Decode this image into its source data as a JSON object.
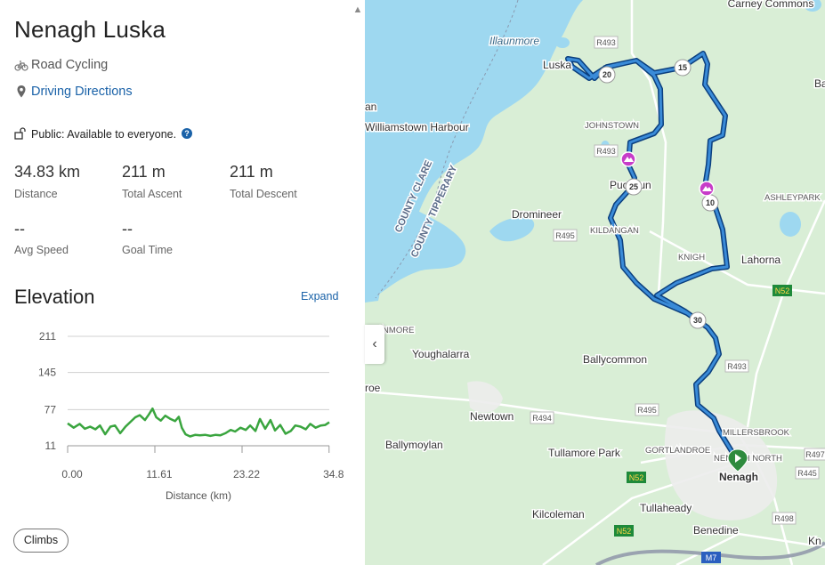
{
  "route": {
    "title": "Nenagh Luska",
    "activity_type": "Road Cycling",
    "directions_link": "Driving Directions",
    "privacy": "Public: Available to everyone.",
    "help_glyph": "?"
  },
  "stats": [
    {
      "value": "34.83 km",
      "label": "Distance"
    },
    {
      "value": "211 m",
      "label": "Total Ascent"
    },
    {
      "value": "211 m",
      "label": "Total Descent"
    },
    {
      "value": "--",
      "label": "Avg Speed"
    },
    {
      "value": "--",
      "label": "Goal Time"
    }
  ],
  "elevation": {
    "title": "Elevation",
    "expand_label": "Expand",
    "climbs_button": "Climbs"
  },
  "chart_data": {
    "type": "line",
    "xlabel": "Distance (km)",
    "ylabel": "",
    "x_ticks": [
      "0.00",
      "11.61",
      "23.22",
      "34.8"
    ],
    "y_ticks": [
      "211",
      "145",
      "77",
      "11"
    ],
    "xlim": [
      0,
      34.83
    ],
    "ylim": [
      11,
      211
    ],
    "grid": true,
    "line_color": "#3aa53f",
    "series": [
      {
        "x": [
          0,
          0.8,
          1.6,
          2.3,
          3.0,
          3.7,
          4.3,
          5.0,
          5.7,
          6.3,
          7.0,
          7.7,
          8.3,
          9.0,
          9.6,
          10.3,
          10.8,
          11.3,
          11.8,
          12.4,
          13.0,
          13.7,
          14.3,
          14.8,
          15.2,
          15.7,
          16.3,
          17.0,
          17.6,
          18.3,
          19.0,
          19.7,
          20.3,
          21.0,
          21.7,
          22.3,
          23.0,
          23.7,
          24.3,
          25.0,
          25.6,
          26.3,
          27.0,
          27.6,
          28.3,
          29.0,
          29.7,
          30.3,
          31.0,
          31.7,
          32.3,
          33.0,
          33.7,
          34.3,
          34.83
        ],
        "y": [
          52,
          44,
          51,
          42,
          46,
          41,
          48,
          32,
          46,
          48,
          34,
          46,
          54,
          63,
          67,
          58,
          68,
          79,
          63,
          57,
          66,
          60,
          56,
          64,
          44,
          32,
          28,
          31,
          30,
          31,
          29,
          31,
          30,
          34,
          40,
          37,
          44,
          40,
          48,
          38,
          60,
          42,
          58,
          39,
          49,
          33,
          38,
          48,
          46,
          41,
          51,
          44,
          48,
          49,
          54
        ]
      }
    ]
  },
  "map": {
    "collapse_glyph": "‹",
    "labels": [
      "Carney Commons",
      "Illaunmore",
      "R493",
      "Luska",
      "Ba",
      "an",
      "Williamstown Harbour",
      "JOHNSTOWN",
      "R493",
      "Puckaun",
      "COUNTY CLARE",
      "COUNTY TIPPERARY",
      "Dromineer",
      "ASHLEYPARK",
      "KILDANGAN",
      "R495",
      "KNIGH",
      "Lahorna",
      "N52",
      "RRANMORE",
      "Youghalarra",
      "Ballycommon",
      "R493",
      "roe",
      "Newtown",
      "R494",
      "R495",
      "MILLERSBROOK",
      "Ballymoylan",
      "GORTLANDROE",
      "NENAGH NORTH",
      "R497",
      "Tullamore Park",
      "N52",
      "Nenagh",
      "R445",
      "Kilcoleman",
      "Tullaheady",
      "R498",
      "N52",
      "Benedine",
      "M7",
      "Kn"
    ],
    "markers": [
      "20",
      "15",
      "25",
      "10",
      "30"
    ],
    "colors": {
      "water": "#9ed8f0",
      "land": "#d9eed6",
      "route": "#2460b0",
      "climb_marker": "#c73cc8",
      "start_marker": "#2e8b3e"
    }
  }
}
